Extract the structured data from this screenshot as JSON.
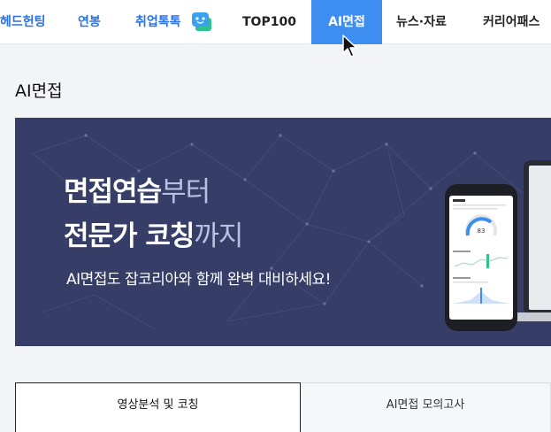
{
  "nav": {
    "items": [
      {
        "label": "헤드헌팅"
      },
      {
        "label": "연봉"
      },
      {
        "label": "취업톡톡"
      },
      {
        "label": "TOP100"
      },
      {
        "label": "AI면접"
      },
      {
        "label": "뉴스·자료"
      },
      {
        "label": "커리어패스"
      }
    ],
    "active_index": 4,
    "icons": [
      "chat-bubble-icon",
      "mouse-cursor-icon"
    ]
  },
  "page": {
    "title": "AI면접"
  },
  "banner": {
    "line1_strong": "면접연습",
    "line1_light": "부터",
    "line2_strong": "전문가 코칭",
    "line2_light": "까지",
    "subcopy": "AI면접도 잡코리아와 함께 완벽 대비하세요!",
    "phone_score": "83"
  },
  "tabs": [
    {
      "label": "영상분석 및 코칭"
    },
    {
      "label": "AI면접 모의고사"
    }
  ],
  "colors": {
    "nav_blue": "#2a72e5",
    "nav_active_bg": "#3d8ef0",
    "banner_bg": "#363e68",
    "page_bg": "#f2f4f7"
  }
}
